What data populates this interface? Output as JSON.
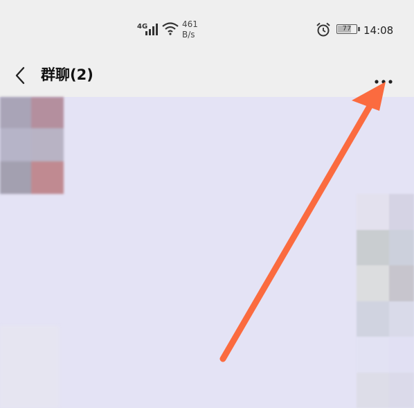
{
  "status_bar": {
    "network": "4G",
    "speed_value": "461",
    "speed_unit": "B/s",
    "battery": "77",
    "battery_level": 0.77,
    "time": "14:08",
    "icons": [
      "signal-icon",
      "wifi-icon",
      "alarm-icon",
      "battery-icon"
    ]
  },
  "header": {
    "title": "群聊(2)",
    "back_icon": "chevron-left-icon",
    "more_icon": "more-dots-icon"
  },
  "annotation": {
    "icon": "arrow-icon",
    "color": "#fb6b3f"
  }
}
